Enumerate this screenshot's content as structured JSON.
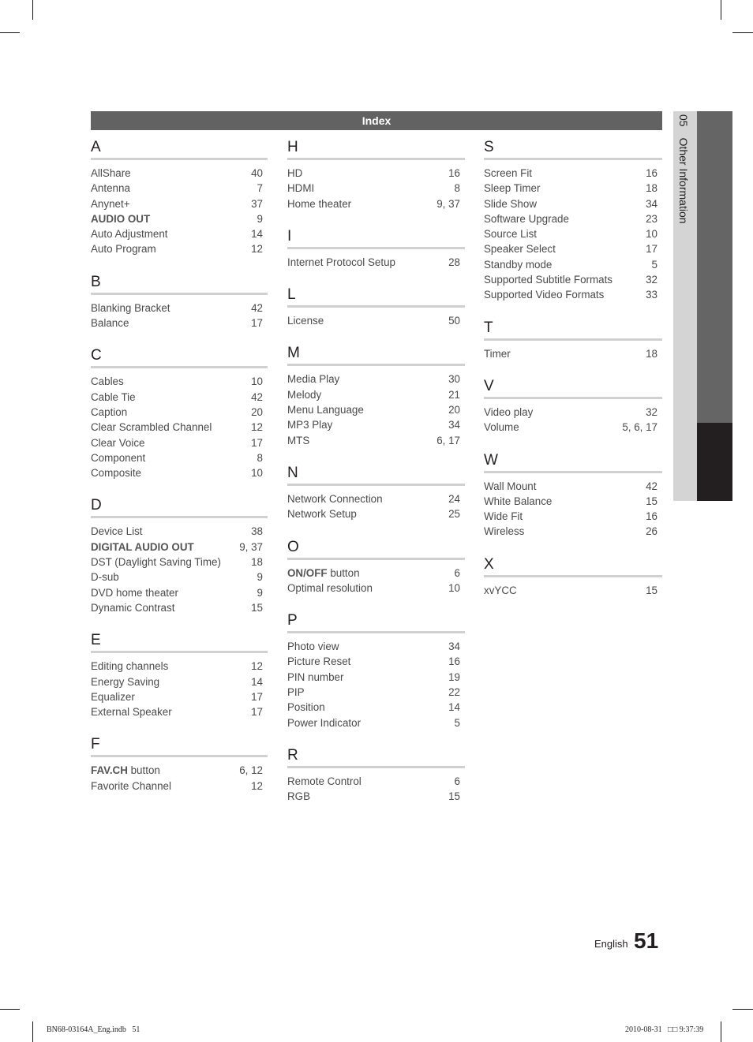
{
  "header": {
    "title": "Index"
  },
  "side_tab": {
    "chapter_number": "05",
    "chapter_title": "Other Information"
  },
  "columns": [
    [
      {
        "letter": "A",
        "entries": [
          {
            "term": "AllShare",
            "pages": "40"
          },
          {
            "term": "Antenna",
            "pages": "7"
          },
          {
            "term": "Anynet+",
            "pages": "37"
          },
          {
            "term_bold": "AUDIO OUT",
            "term": "",
            "pages": "9"
          },
          {
            "term": "Auto Adjustment",
            "pages": "14"
          },
          {
            "term": "Auto Program",
            "pages": "12"
          }
        ]
      },
      {
        "letter": "B",
        "entries": [
          {
            "term": "Blanking Bracket",
            "pages": "42"
          },
          {
            "term": "Balance",
            "pages": "17"
          }
        ]
      },
      {
        "letter": "C",
        "entries": [
          {
            "term": "Cables",
            "pages": "10"
          },
          {
            "term": "Cable Tie",
            "pages": "42"
          },
          {
            "term": "Caption",
            "pages": "20"
          },
          {
            "term": "Clear Scrambled Channel",
            "pages": "12"
          },
          {
            "term": "Clear Voice",
            "pages": "17"
          },
          {
            "term": "Component",
            "pages": "8"
          },
          {
            "term": "Composite",
            "pages": "10"
          }
        ]
      },
      {
        "letter": "D",
        "entries": [
          {
            "term": "Device List",
            "pages": "38"
          },
          {
            "term_bold": "DIGITAL AUDIO OUT",
            "term": "",
            "pages": "9, 37"
          },
          {
            "term": "DST (Daylight Saving Time)",
            "pages": "18"
          },
          {
            "term": "D-sub",
            "pages": "9"
          },
          {
            "term": "DVD home theater",
            "pages": "9"
          },
          {
            "term": "Dynamic Contrast",
            "pages": "15"
          }
        ]
      },
      {
        "letter": "E",
        "entries": [
          {
            "term": "Editing channels",
            "pages": "12"
          },
          {
            "term": "Energy Saving",
            "pages": "14"
          },
          {
            "term": "Equalizer",
            "pages": "17"
          },
          {
            "term": "External Speaker",
            "pages": "17"
          }
        ]
      },
      {
        "letter": "F",
        "entries": [
          {
            "term_bold": "FAV.CH",
            "term": " button",
            "pages": "6, 12"
          },
          {
            "term": "Favorite Channel",
            "pages": "12"
          }
        ]
      }
    ],
    [
      {
        "letter": "H",
        "entries": [
          {
            "term": "HD",
            "pages": "16"
          },
          {
            "term": "HDMI",
            "pages": "8"
          },
          {
            "term": "Home theater",
            "pages": "9, 37"
          }
        ]
      },
      {
        "letter": "I",
        "entries": [
          {
            "term": "Internet Protocol Setup",
            "pages": "28"
          }
        ]
      },
      {
        "letter": "L",
        "entries": [
          {
            "term": "License",
            "pages": "50"
          }
        ]
      },
      {
        "letter": "M",
        "entries": [
          {
            "term": "Media Play",
            "pages": "30"
          },
          {
            "term": "Melody",
            "pages": "21"
          },
          {
            "term": "Menu Language",
            "pages": "20"
          },
          {
            "term": "MP3 Play",
            "pages": "34"
          },
          {
            "term": "MTS",
            "pages": "6, 17"
          }
        ]
      },
      {
        "letter": "N",
        "entries": [
          {
            "term": "Network Connection",
            "pages": "24"
          },
          {
            "term": "Network Setup",
            "pages": "25"
          }
        ]
      },
      {
        "letter": "O",
        "entries": [
          {
            "term_bold": "ON/OFF",
            "term": " button",
            "pages": "6"
          },
          {
            "term": "Optimal resolution",
            "pages": "10"
          }
        ]
      },
      {
        "letter": "P",
        "entries": [
          {
            "term": "Photo view",
            "pages": "34"
          },
          {
            "term": "Picture Reset",
            "pages": "16"
          },
          {
            "term": "PIN number",
            "pages": "19"
          },
          {
            "term": "PIP",
            "pages": "22"
          },
          {
            "term": "Position",
            "pages": "14"
          },
          {
            "term": "Power Indicator",
            "pages": "5"
          }
        ]
      },
      {
        "letter": "R",
        "entries": [
          {
            "term": "Remote Control",
            "pages": "6"
          },
          {
            "term": "RGB",
            "pages": "15"
          }
        ]
      }
    ],
    [
      {
        "letter": "S",
        "entries": [
          {
            "term": "Screen Fit",
            "pages": "16"
          },
          {
            "term": "Sleep Timer",
            "pages": "18"
          },
          {
            "term": "Slide Show",
            "pages": "34"
          },
          {
            "term": "Software Upgrade",
            "pages": "23"
          },
          {
            "term": "Source List",
            "pages": "10"
          },
          {
            "term": "Speaker Select",
            "pages": "17"
          },
          {
            "term": "Standby mode",
            "pages": "5"
          },
          {
            "term": "Supported Subtitle Formats",
            "pages": "32"
          },
          {
            "term": "Supported Video Formats",
            "pages": "33"
          }
        ]
      },
      {
        "letter": "T",
        "entries": [
          {
            "term": "Timer",
            "pages": "18"
          }
        ]
      },
      {
        "letter": "V",
        "entries": [
          {
            "term": "Video play",
            "pages": "32"
          },
          {
            "term": "Volume",
            "pages": "5, 6, 17"
          }
        ]
      },
      {
        "letter": "W",
        "entries": [
          {
            "term": "Wall Mount",
            "pages": "42"
          },
          {
            "term": "White Balance",
            "pages": "15"
          },
          {
            "term": "Wide Fit",
            "pages": "16"
          },
          {
            "term": "Wireless",
            "pages": "26"
          }
        ]
      },
      {
        "letter": "X",
        "entries": [
          {
            "term": "xvYCC",
            "pages": "15"
          }
        ]
      }
    ]
  ],
  "footer": {
    "language": "English",
    "page_number": "51"
  },
  "slug": {
    "left": "BN68-03164A_Eng.indb   51",
    "right": "2010-08-31   □□ 9:37:39"
  },
  "colors": {
    "header_bar": "#636262",
    "rule": "#d0d0d0",
    "tab_light": "#d4d4d4",
    "tab_gray": "#666565",
    "tab_dark": "#231f20"
  }
}
